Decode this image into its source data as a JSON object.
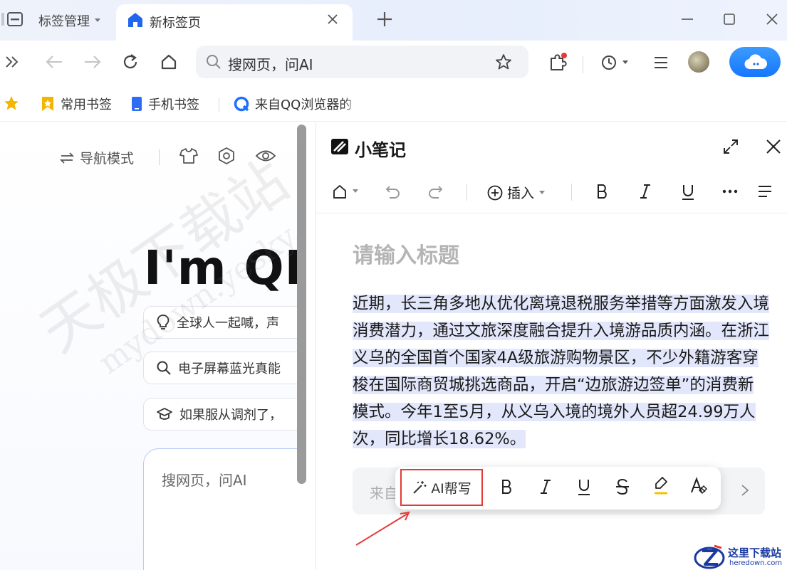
{
  "tabs": {
    "manager_label": "标签管理",
    "active_label": "新标签页"
  },
  "toolbar": {
    "search_placeholder": "搜网页，问AI"
  },
  "bookmarks": [
    {
      "label": "常用书签",
      "icon": "bookmark-folder-icon",
      "color": "#f5b400"
    },
    {
      "label": "手机书签",
      "icon": "phone-bookmark-icon",
      "color": "#2f6cf6"
    },
    {
      "label": "来自QQ浏览器的",
      "icon": "qq-browser-icon",
      "color": "#1e6fff"
    }
  ],
  "left_page": {
    "nav_mode_label": "导航模式",
    "hero_text": "I'm QB",
    "suggestions": [
      {
        "icon": "lightbulb-icon",
        "text": "全球人一起喊，声"
      },
      {
        "icon": "search-icon",
        "text": "电子屏幕蓝光真能"
      },
      {
        "icon": "graduation-cap-icon",
        "text": "如果服从调剂了，"
      }
    ],
    "search_placeholder": "搜网页，问AI"
  },
  "watermark": {
    "text": "天极下载站",
    "url": "mydown.yesky.com"
  },
  "note": {
    "title": "小笔记",
    "insert_label": "插入",
    "title_placeholder": "请输入标题",
    "body": "近期，长三角多地从优化离境退税服务举措等方面激发入境消费潜力，通过文旅深度融合提升入境游品质内涵。在浙江义乌的全国首个国家4A级旅游购物景区，不少外籍游客穿梭在国际商贸城挑选商品，开启“边旅游边签单”的消费新模式。今年1至5月，从义乌入境的境外人员超24.99万人次，同比增长18.62%。",
    "source_prefix": "来自",
    "ai_button_label": "AI帮写",
    "highlight_color": "#e3e7fb",
    "callout_color": "#e53935"
  },
  "site_logo": {
    "name": "这里下载站",
    "url": "heredown.com"
  }
}
